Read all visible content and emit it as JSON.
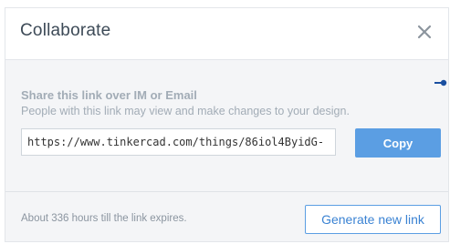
{
  "dialog": {
    "title": "Collaborate",
    "close_icon": "close-icon"
  },
  "share": {
    "heading": "Share this link over IM or Email",
    "description": "People with this link may view and make changes to your design.",
    "link_value": "https://www.tinkercad.com/things/86iol4ByidG-",
    "copy_label": "Copy"
  },
  "footer": {
    "expires_text": "About 336 hours till the link expires.",
    "generate_label": "Generate new link"
  },
  "colors": {
    "accent": "#5b9ee3",
    "title_text": "#3d4a57",
    "muted_text": "#a2acb6",
    "panel_bg": "#f4f5f7",
    "pointer": "#1a4fa0"
  }
}
